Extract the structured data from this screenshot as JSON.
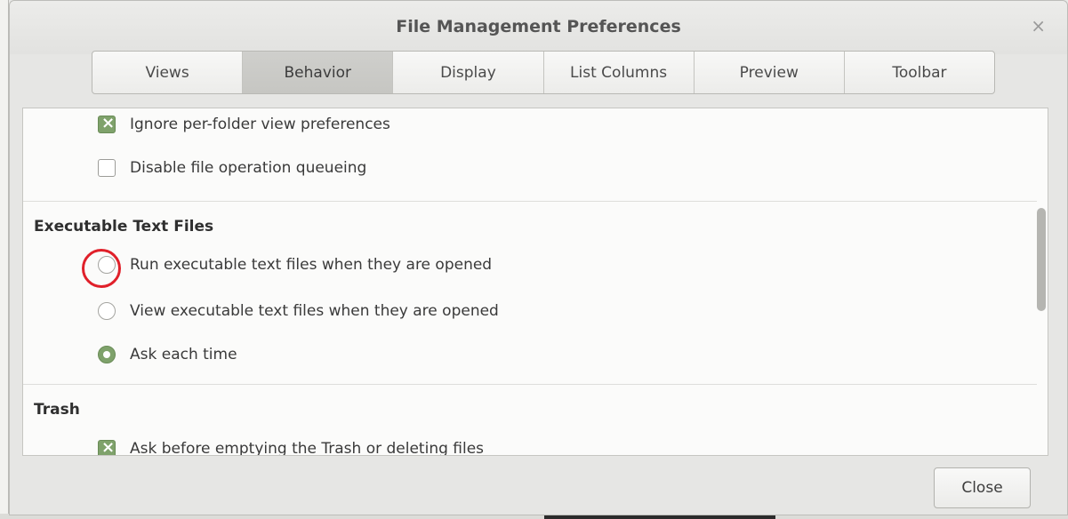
{
  "window": {
    "title": "File Management Preferences",
    "close_icon": "×"
  },
  "tabs": [
    {
      "label": "Views"
    },
    {
      "label": "Behavior",
      "active": true
    },
    {
      "label": "Display"
    },
    {
      "label": "List Columns"
    },
    {
      "label": "Preview"
    },
    {
      "label": "Toolbar"
    }
  ],
  "options": {
    "ignore_per_folder": {
      "label": "Ignore per-folder view preferences",
      "checked": true
    },
    "disable_queueing": {
      "label": "Disable file operation queueing",
      "checked": false
    }
  },
  "executable": {
    "heading": "Executable Text Files",
    "run": {
      "label": "Run executable text files when they are opened",
      "selected": false
    },
    "view": {
      "label": "View executable text files when they are opened",
      "selected": false
    },
    "ask": {
      "label": "Ask each time",
      "selected": true
    }
  },
  "trash": {
    "heading": "Trash",
    "ask_before_emptying": {
      "label": "Ask before emptying the Trash or deleting files",
      "checked": true
    }
  },
  "footer": {
    "close_label": "Close"
  },
  "colors": {
    "accent": "#7fa26b",
    "highlight": "#e0202a"
  }
}
